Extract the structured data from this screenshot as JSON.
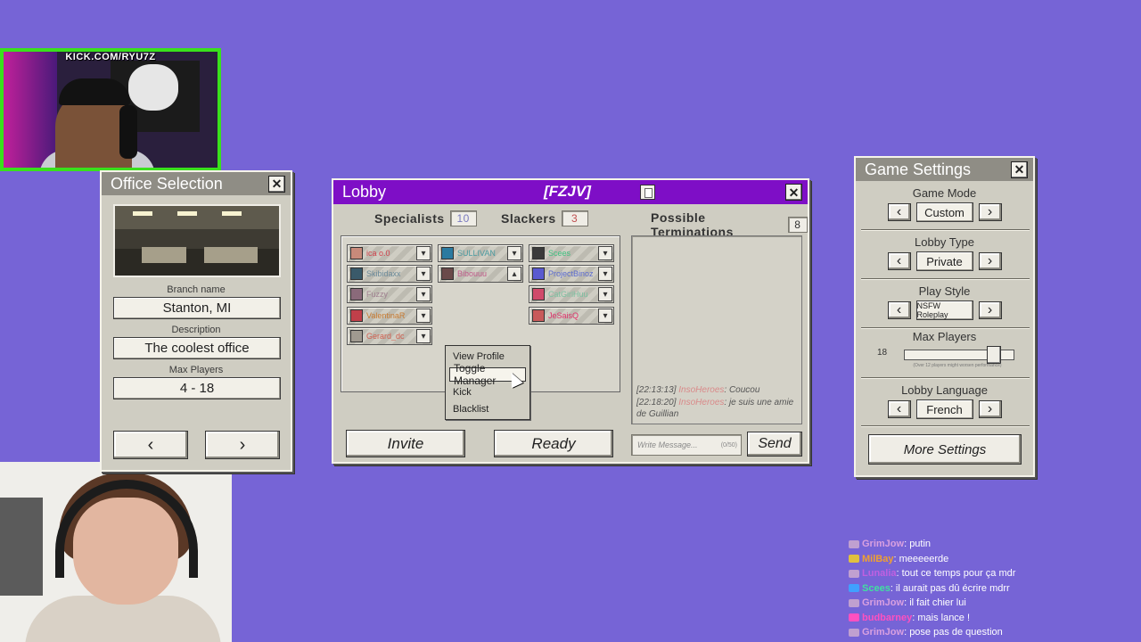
{
  "stream": {
    "channel_label": "KICK.COM/RYU7Z"
  },
  "office_selection": {
    "title": "Office Selection",
    "close_label": "✕",
    "branch_label": "Branch name",
    "branch_value": "Stanton, MI",
    "description_label": "Description",
    "description_value": "The coolest office",
    "max_players_label": "Max Players",
    "max_players_value": "4 - 18",
    "prev_label": "‹",
    "next_label": "›"
  },
  "lobby": {
    "title": "Lobby",
    "code": "[FZJV]",
    "close_label": "✕",
    "specialists_label": "Specialists",
    "specialists_count": "10",
    "slackers_label": "Slackers",
    "slackers_count": "3",
    "terminations_label": "Possible Terminations",
    "terminations_count": "8",
    "slots": [
      {
        "name": "ica o.0",
        "color": "#d0404a",
        "avatar": "#c88a7a",
        "arrow": "▾"
      },
      {
        "name": "Skibidaxx",
        "color": "#6a8a9a",
        "avatar": "#3a5a6a",
        "arrow": "▾"
      },
      {
        "name": "Fuzzy",
        "color": "#a08090",
        "avatar": "#8a6a7a",
        "arrow": "▾"
      },
      {
        "name": "ValentinaR",
        "color": "#c87a30",
        "avatar": "#c0404a",
        "arrow": "▾"
      },
      {
        "name": "Gerard_dc",
        "color": "#d06050",
        "avatar": "#a09a90",
        "arrow": "▾"
      },
      {
        "name": "SULLIVAN",
        "color": "#4a9aa0",
        "avatar": "#2a7aa0",
        "arrow": "▾"
      },
      {
        "name": "Bibouuu",
        "color": "#c05a8a",
        "avatar": "#6a4a4a",
        "arrow": "▴"
      },
      {
        "name": "Scees",
        "color": "#40c080",
        "avatar": "#3a3a3a",
        "arrow": "▾"
      },
      {
        "name": "ProjectBinoz",
        "color": "#5a6ad0",
        "avatar": "#5a5ad0",
        "arrow": "▾"
      },
      {
        "name": "CatGirlHuu",
        "color": "#7ac0a0",
        "avatar": "#d04a6a",
        "arrow": "▾"
      },
      {
        "name": "JeSaisQ",
        "color": "#e0306a",
        "avatar": "#c85a5a",
        "arrow": "▾"
      }
    ],
    "context_menu": {
      "view_profile": "View Profile",
      "toggle_manager": "Toggle Manager",
      "kick": "Kick",
      "blacklist": "Blacklist"
    },
    "chat": [
      {
        "time": "[22:13:13]",
        "user": "InsoHeroes",
        "text": ": Coucou"
      },
      {
        "time": "[22:18:20]",
        "user": "InsoHeroes",
        "text": ": je suis une amie de Guillian"
      }
    ],
    "invite_label": "Invite",
    "ready_label": "Ready",
    "message_placeholder": "Write Message...",
    "message_counter": "(0/50)",
    "send_label": "Send"
  },
  "game_settings": {
    "title": "Game Settings",
    "close_label": "✕",
    "game_mode_label": "Game Mode",
    "game_mode_value": "Custom",
    "lobby_type_label": "Lobby Type",
    "lobby_type_value": "Private",
    "play_style_label": "Play Style",
    "play_style_value": "NSFW Roleplay",
    "max_players_label": "Max Players",
    "max_players_value": "18",
    "max_players_note": "(Over 12 players might worsen performance)",
    "lobby_language_label": "Lobby Language",
    "lobby_language_value": "French",
    "prev_arrow": "‹",
    "next_arrow": "›",
    "more_settings_label": "More Settings"
  },
  "stream_chat": [
    {
      "user": "GrimJow",
      "color": "#d9a0e0",
      "badge": "#c0a0d0",
      "text": ": putin"
    },
    {
      "user": "MilBay",
      "color": "#f0a030",
      "badge": "#e0c040",
      "text": ": meeeeerde"
    },
    {
      "user": "Lunalia",
      "color": "#c060e0",
      "badge": "#c0a0d0",
      "text": ": tout ce temps pour ça mdr"
    },
    {
      "user": "Scees",
      "color": "#40e0a0",
      "badge": "#40a0ff",
      "text": ": il aurait pas dû écrire mdrr"
    },
    {
      "user": "GrimJow",
      "color": "#d9a0e0",
      "badge": "#c0a0d0",
      "text": ": il fait chier lui"
    },
    {
      "user": "budbarney",
      "color": "#ff50c0",
      "badge": "#ff50c0",
      "text": ": mais lance !"
    },
    {
      "user": "GrimJow",
      "color": "#d9a0e0",
      "badge": "#c0a0d0",
      "text": ": pose pas de question"
    }
  ]
}
